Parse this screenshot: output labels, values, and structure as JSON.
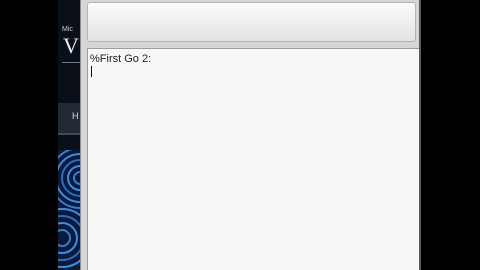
{
  "background_window": {
    "logo_small": "Mic",
    "logo_large": "V",
    "band_label": "H"
  },
  "editor": {
    "text": "%First Go 2:"
  },
  "colors": {
    "editor_background": "#f7f7f7",
    "window_chrome": "#d6d6d6",
    "background_pattern": "#2f7fd0"
  },
  "icons": {
    "background_pattern": "circle-pattern-icon"
  }
}
